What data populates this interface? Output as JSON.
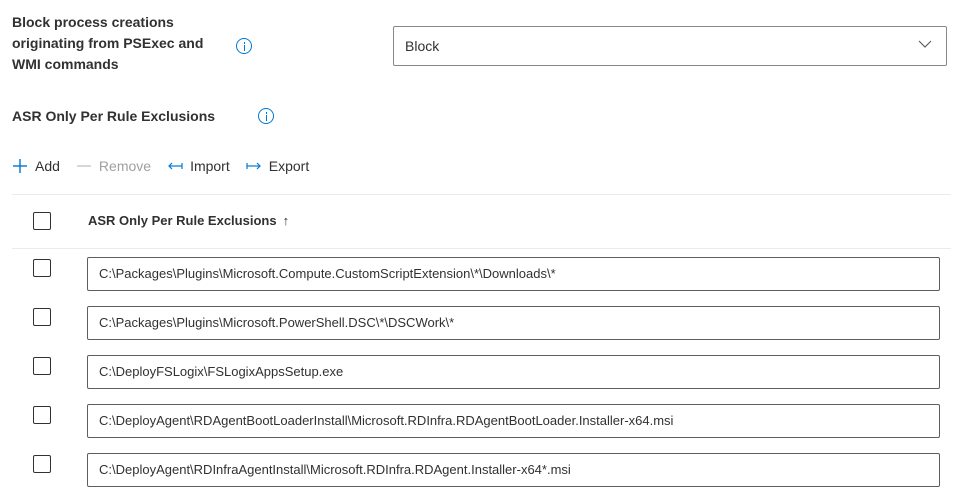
{
  "setting": {
    "label": "Block process creations originating from PSExec and WMI commands",
    "info_icon": "info-icon",
    "dropdown_value": "Block",
    "dropdown_icon": "chevron-down-icon"
  },
  "exclusions": {
    "label": "ASR Only Per Rule Exclusions",
    "info_icon": "info-icon"
  },
  "toolbar": {
    "add_label": "Add",
    "add_icon": "plus-icon",
    "remove_label": "Remove",
    "remove_icon": "minus-icon",
    "import_label": "Import",
    "import_icon": "import-arrow-icon",
    "export_label": "Export",
    "export_icon": "export-arrow-icon"
  },
  "table": {
    "column_header": "ASR Only Per Rule Exclusions",
    "sort_indicator": "↑",
    "rows": [
      "C:\\Packages\\Plugins\\Microsoft.Compute.CustomScriptExtension\\*\\Downloads\\*",
      "C:\\Packages\\Plugins\\Microsoft.PowerShell.DSC\\*\\DSCWork\\*",
      "C:\\DeployFSLogix\\FSLogixAppsSetup.exe",
      "C:\\DeployAgent\\RDAgentBootLoaderInstall\\Microsoft.RDInfra.RDAgentBootLoader.Installer-x64.msi",
      "C:\\DeployAgent\\RDInfraAgentInstall\\Microsoft.RDInfra.RDAgent.Installer-x64*.msi"
    ]
  },
  "colors": {
    "accent": "#0078d4",
    "text": "#323130",
    "disabled": "#a19f9d",
    "border": "#8a8886"
  }
}
